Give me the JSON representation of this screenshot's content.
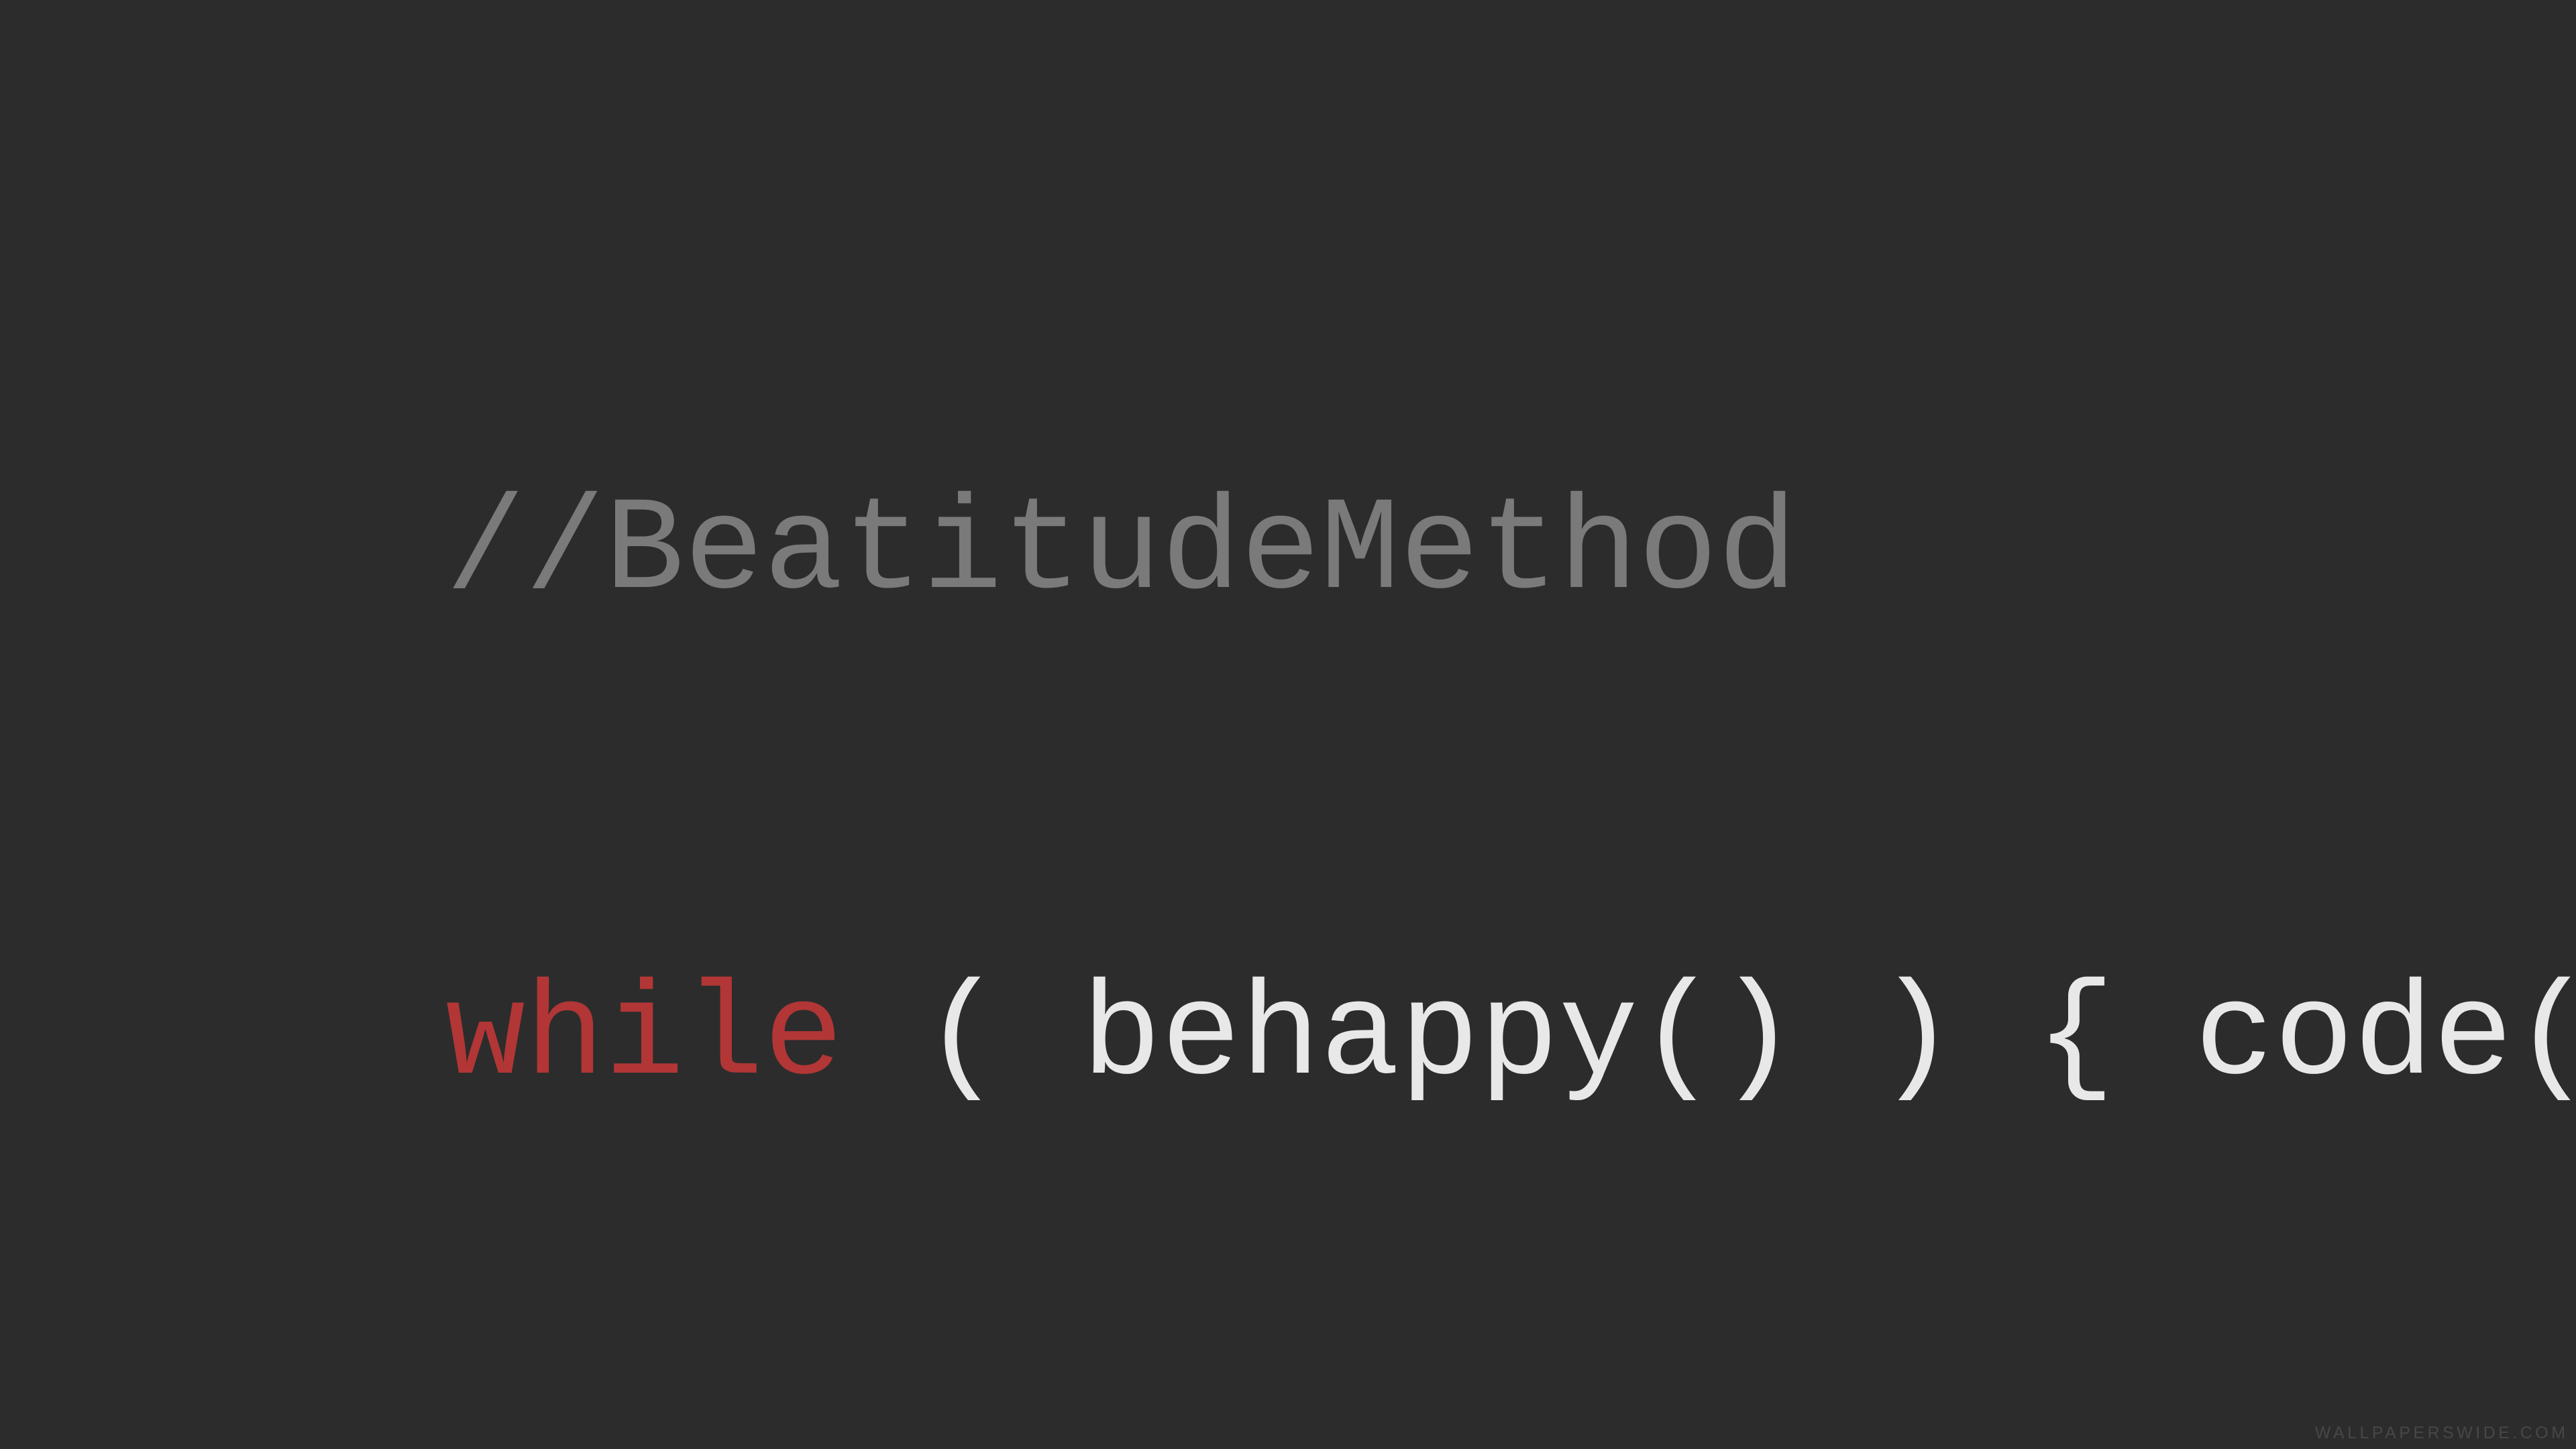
{
  "code": {
    "comment": "//BeatitudeMethod",
    "keyword": "while",
    "body_rest": " ( behappy() ) { code(); }"
  },
  "watermark": "WALLPAPERSWIDE.COM",
  "colors": {
    "background": "#2c2c2c",
    "comment": "#7a7a7a",
    "keyword": "#b23636",
    "text": "#e8e8e8"
  }
}
